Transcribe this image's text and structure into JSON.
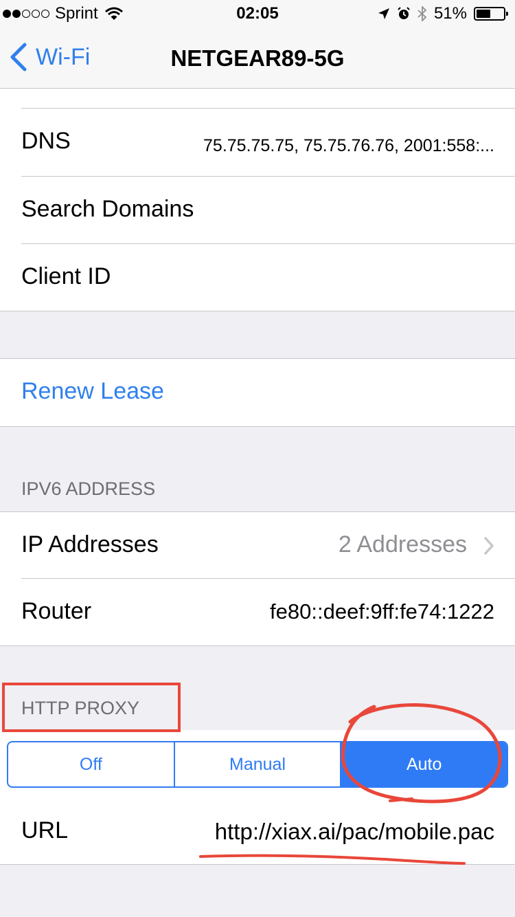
{
  "status_bar": {
    "carrier": "Sprint",
    "time": "02:05",
    "battery": "51%"
  },
  "nav": {
    "back_label": "Wi-Fi",
    "title": "NETGEAR89-5G"
  },
  "dhcp": {
    "dns_label": "DNS",
    "dns_value": "75.75.75.75, 75.75.76.76, 2001:558:...",
    "search_domains_label": "Search Domains",
    "client_id_label": "Client ID"
  },
  "renew_lease_label": "Renew Lease",
  "ipv6": {
    "header": "IPV6 ADDRESS",
    "ip_addresses_label": "IP Addresses",
    "ip_addresses_value": "2 Addresses",
    "router_label": "Router",
    "router_value": "fe80::deef:9ff:fe74:1222"
  },
  "http_proxy": {
    "header": "HTTP PROXY",
    "options": [
      "Off",
      "Manual",
      "Auto"
    ],
    "selected": "Auto",
    "url_label": "URL",
    "url_value": "http://xiax.ai/pac/mobile.pac"
  },
  "colors": {
    "accent": "#2f7bf5",
    "annotation": "#e8473a"
  }
}
